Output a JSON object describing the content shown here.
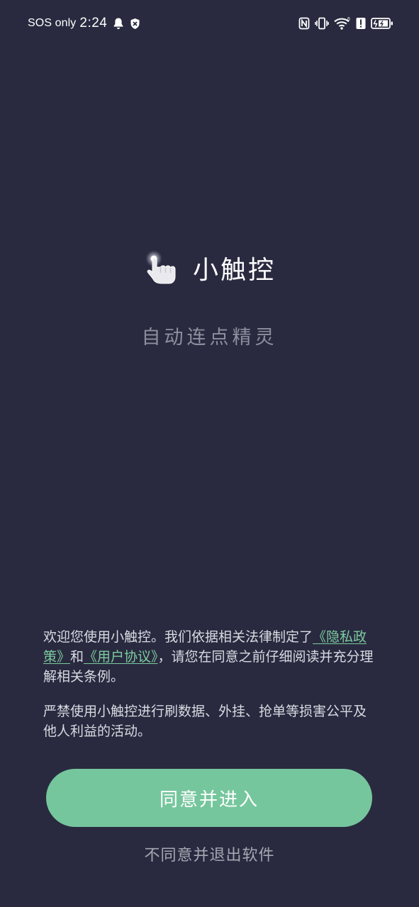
{
  "status_bar": {
    "carrier": "SOS only",
    "time": "2:24",
    "left_icons": [
      "bell-icon",
      "vpn-shield-icon"
    ],
    "right_icons": [
      "nfc-icon",
      "vibrate-icon",
      "wifi-icon",
      "alert-icon",
      "battery-charging-icon"
    ]
  },
  "app": {
    "icon": "tap-hand-icon",
    "name": "小触控",
    "tagline": "自动连点精灵"
  },
  "agreement": {
    "p1_before": "欢迎您使用小触控。我们依据相关法律制定了",
    "privacy_link": "《隐私政策》",
    "p1_mid": "和",
    "terms_link": "《用户协议》",
    "p1_after": "，请您在同意之前仔细阅读并充分理解相关条例。",
    "p2": "严禁使用小触控进行刷数据、外挂、抢单等损害公平及他人利益的活动。"
  },
  "buttons": {
    "agree": "同意并进入",
    "disagree": "不同意并退出软件"
  },
  "colors": {
    "background": "#292a3f",
    "accent": "#76c69d",
    "link": "#7ccc9f",
    "text": "#d9dae2",
    "muted": "#8e8f9e"
  }
}
